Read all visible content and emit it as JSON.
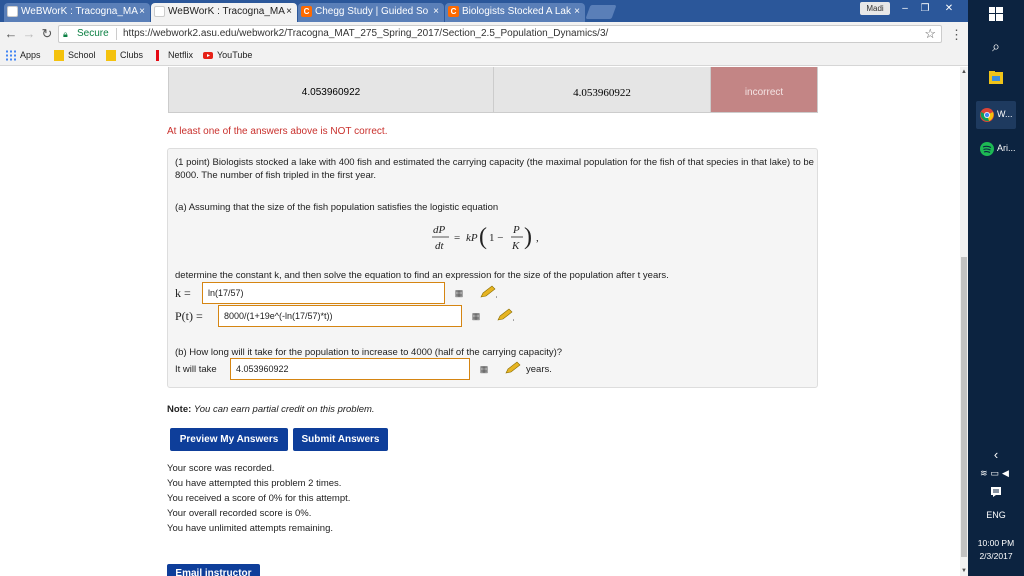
{
  "browser": {
    "tabs": [
      {
        "title": "WeBWorK : Tracogna_MA",
        "close": "×",
        "favicon": "webwork-favicon-icon"
      },
      {
        "title": "WeBWorK : Tracogna_MA",
        "close": "×",
        "favicon": "webwork-favicon-icon"
      },
      {
        "title": "Chegg Study | Guided So",
        "close": "×",
        "favicon": "chegg-favicon-icon"
      },
      {
        "title": "Biologists Stocked A Lak",
        "close": "×",
        "favicon": "chegg-favicon-icon"
      }
    ],
    "profile_name": "Madi",
    "secure_label": "Secure",
    "url": "https://webwork2.asu.edu/webwork2/Tracogna_MAT_275_Spring_2017/Section_2.5_Population_Dynamics/3/",
    "bookmarks": [
      {
        "label": "Apps",
        "icon": "apps-grid-icon"
      },
      {
        "label": "School",
        "icon": "folder-icon"
      },
      {
        "label": "Clubs",
        "icon": "folder-icon"
      },
      {
        "label": "Netflix",
        "icon": "netflix-icon"
      },
      {
        "label": "YouTube",
        "icon": "youtube-icon"
      }
    ]
  },
  "results_table": {
    "entered": "4.053960922",
    "preview": "4.053960922",
    "result": "incorrect",
    "result_color": "#c38585"
  },
  "warning": "At least one of the answers above is NOT correct.",
  "problem": {
    "intro": "(1 point) Biologists stocked a lake with 400 fish and estimated the carrying capacity (the maximal population for the fish of that species in that lake) to be 8000. The number of fish tripled in the first year.",
    "part_a": "(a) Assuming that the size of the fish population satisfies the logistic equation",
    "determine": "determine the constant k, and then solve the equation to find an expression for the size of the population after t years.",
    "k_label": "k =",
    "k_value": "ln(17/57)",
    "p_label": "P(t) =",
    "p_value": "8000/(1+19e^(-ln(17/57)*t))",
    "part_b": "(b) How long will it take for the population to increase to 4000 (half of the carrying capacity)?",
    "it_will_take": "It will take",
    "b_value": "4.053960922",
    "years": "years."
  },
  "note_label": "Note:",
  "note_text": "You can earn partial credit on this problem.",
  "buttons": {
    "preview": "Preview My Answers",
    "submit": "Submit Answers",
    "email": "Email instructor"
  },
  "score_lines": [
    "Your score was recorded.",
    "You have attempted this problem 2 times.",
    "You received a score of 0% for this attempt.",
    "Your overall recorded score is 0%.",
    "You have unlimited attempts remaining."
  ],
  "taskbar": {
    "chrome_label": "W...",
    "spotify_label": "Ari...",
    "language": "ENG",
    "time": "10:00 PM",
    "date": "2/3/2017"
  },
  "colors": {
    "accent_button": "#0e3e9a",
    "warning": "#c9302c",
    "input_border": "#d58512",
    "taskbar": "#0c2340"
  }
}
